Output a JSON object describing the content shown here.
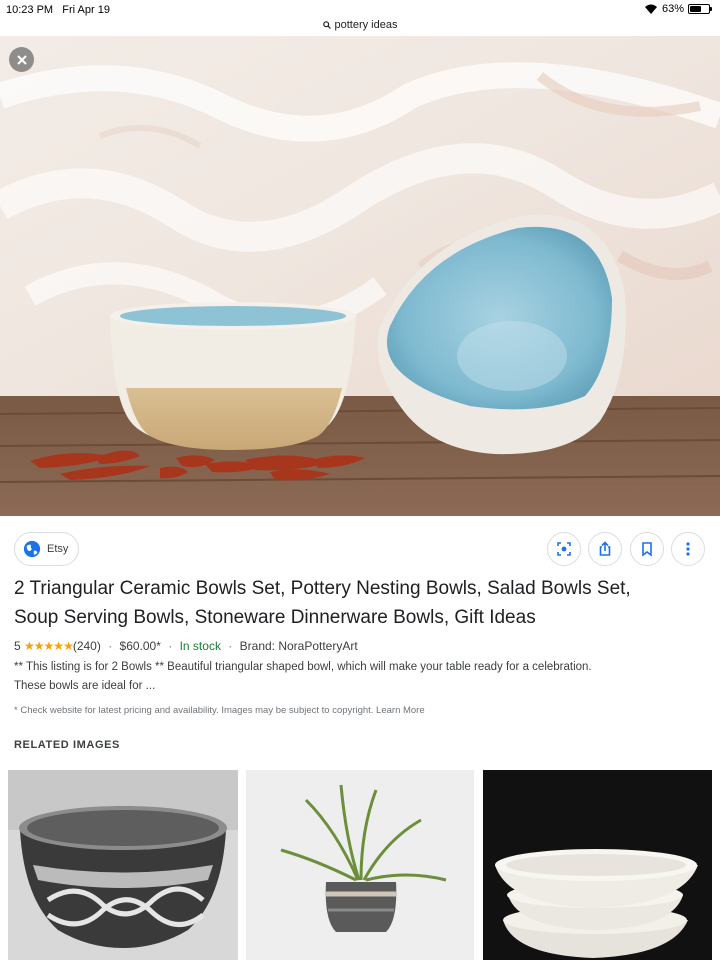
{
  "status_bar": {
    "time": "10:23 PM",
    "date": "Fri Apr 19",
    "battery_percent_label": "63%",
    "battery_level": 0.63
  },
  "url_bar": {
    "query": "pottery ideas",
    "icon": "search-icon"
  },
  "viewer": {
    "close_icon": "close-icon"
  },
  "source": {
    "site_name": "Etsy",
    "icon": "globe-icon"
  },
  "actions": [
    {
      "name": "lens-icon"
    },
    {
      "name": "share-icon"
    },
    {
      "name": "bookmark-icon"
    },
    {
      "name": "more-vert-icon"
    }
  ],
  "result": {
    "title_line1": "2 Triangular Ceramic Bowls Set, Pottery Nesting Bowls, Salad Bowls Set,",
    "title_line2": "Soup Serving Bowls, Stoneware Dinnerware Bowls, Gift Ideas",
    "rating_value": "5",
    "stars": "★★★★★",
    "review_count": "(240)",
    "price": "$60.00*",
    "stock": "In stock",
    "brand": "Brand: NoraPotteryArt",
    "description_line1": "** This listing is for 2 Bowls ** Beautiful triangular shaped bowl, which will make your table ready for a celebration.",
    "description_line2": "These bowls are ideal for ...",
    "note": "* Check website for latest pricing and availability. Images may be subject to copyright. Learn More"
  },
  "related": {
    "heading": "RELATED IMAGES"
  },
  "colors": {
    "stock_green": "#188038",
    "star_gold": "#f4a300",
    "action_blue": "#1a73e8"
  }
}
